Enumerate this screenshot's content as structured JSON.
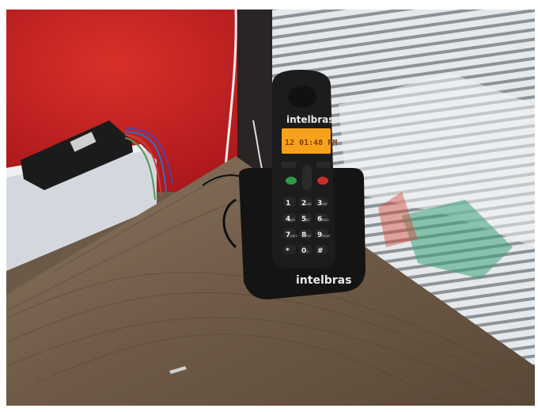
{
  "scene": {
    "description_tags": [
      "cordless-phone",
      "wooden-desk",
      "red-wall",
      "window-blinds"
    ],
    "handset_brand": "intelbras",
    "base_brand": "intelbras",
    "lcd_text": "12 01:48 PM",
    "keypad": [
      {
        "digit": "1",
        "sub": ""
      },
      {
        "digit": "2",
        "sub": "abc"
      },
      {
        "digit": "3",
        "sub": "def"
      },
      {
        "digit": "4",
        "sub": "ghi"
      },
      {
        "digit": "5",
        "sub": "jkl"
      },
      {
        "digit": "6",
        "sub": "mno"
      },
      {
        "digit": "7",
        "sub": "pqrs"
      },
      {
        "digit": "8",
        "sub": "tuv"
      },
      {
        "digit": "9",
        "sub": "wxyz"
      },
      {
        "digit": "*",
        "sub": ""
      },
      {
        "digit": "0",
        "sub": "+"
      },
      {
        "digit": "#",
        "sub": ""
      }
    ],
    "colors": {
      "wall_red": "#c8201e",
      "desk_wood": "#6e5a46",
      "phone_black": "#161616",
      "lcd_orange": "#f7a21b",
      "blinds": "#d9dde0"
    }
  }
}
